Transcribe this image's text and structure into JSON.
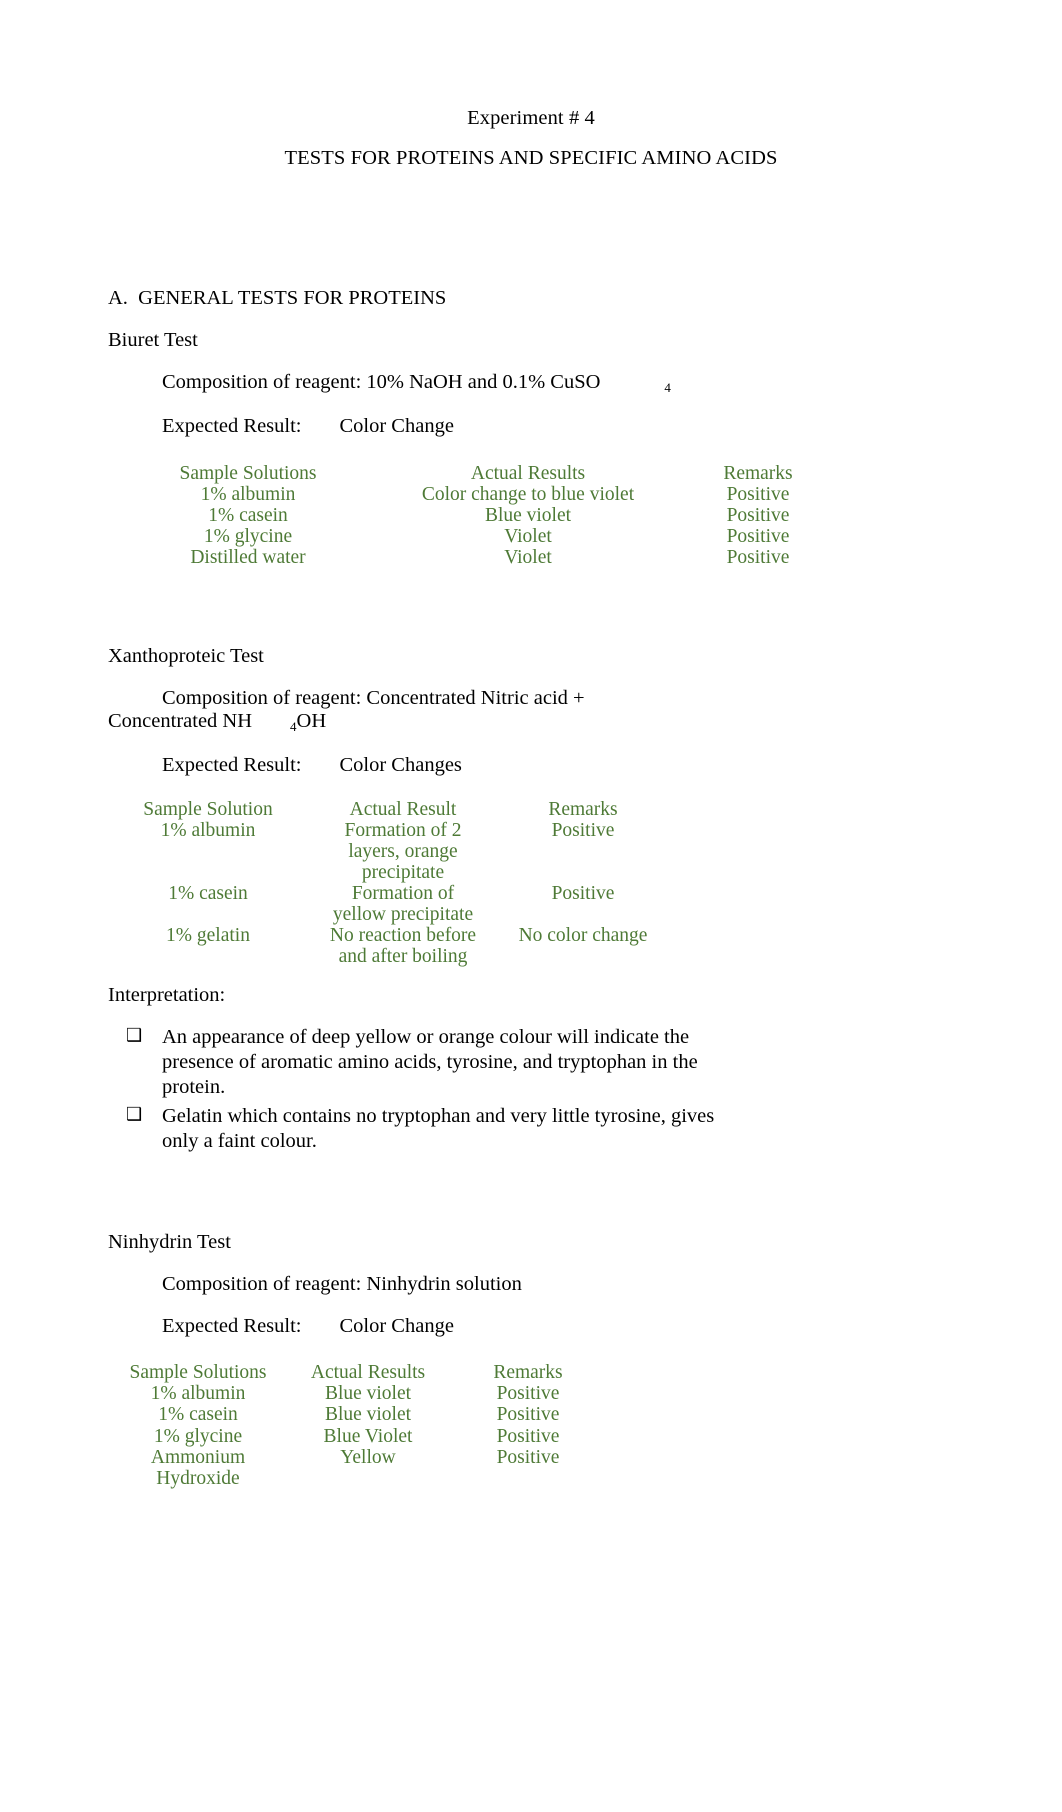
{
  "document": {
    "title": "Experiment # 4",
    "subtitle": "TESTS FOR PROTEINS AND SPECIFIC AMINO ACIDS"
  },
  "section_a": {
    "heading": "A.  GENERAL TESTS FOR PROTEINS"
  },
  "biuret": {
    "test_name": "Biuret Test",
    "composition": "Composition of reagent: 10% NaOH and 0.1% CuSO",
    "composition_subscript": "4",
    "expected_label": "Expected Result:",
    "expected_value": "Color Change",
    "headers": [
      "Sample Solutions",
      "Actual Results",
      "Remarks"
    ],
    "rows": [
      [
        "1% albumin",
        "Color change to blue violet",
        "Positive"
      ],
      [
        "1% casein",
        "Blue violet",
        "Positive"
      ],
      [
        "1% glycine",
        "Violet",
        "Positive"
      ],
      [
        "Distilled water",
        "Violet",
        "Positive"
      ]
    ]
  },
  "xanthoproteic": {
    "test_name": "Xanthoproteic Test",
    "composition_line1": "Composition of reagent: Concentrated Nitric acid +",
    "composition_line2_a": "Concentrated NH",
    "composition_subscript": "4",
    "composition_line2_b": "OH",
    "expected_label": "Expected Result:",
    "expected_value": "Color Changes",
    "headers": [
      "Sample Solution",
      "Actual Result",
      "Remarks"
    ],
    "rows": [
      {
        "sample": "1% albumin",
        "result_line1": "Formation of 2",
        "result_line2": "layers, orange",
        "result_line3": "precipitate",
        "remarks": "Positive"
      },
      {
        "sample": "1% casein",
        "result_line1": "Formation of",
        "result_line2": "yellow precipitate",
        "result_line3": "",
        "remarks": "Positive"
      },
      {
        "sample": "1% gelatin",
        "result_line1": "No reaction before",
        "result_line2": "and after boiling",
        "result_line3": "",
        "remarks": "No color change"
      }
    ],
    "interpretation_label": "Interpretation:",
    "bullet_glyph": "❑",
    "bullets": [
      "An appearance of deep yellow or orange colour will indicate the presence of aromatic amino acids, tyrosine, and tryptophan in the protein.",
      "Gelatin which contains no tryptophan and very little tyrosine, gives only a faint colour."
    ]
  },
  "ninhydrin": {
    "test_name": "Ninhydrin Test",
    "composition": "Composition of reagent: Ninhydrin solution",
    "expected_label": "Expected Result:",
    "expected_value": "Color Change",
    "headers": [
      "Sample Solutions",
      "Actual Results",
      "Remarks"
    ],
    "rows": [
      {
        "sample_line1": "1% albumin",
        "sample_line2": "",
        "result": "Blue violet",
        "remarks": "Positive"
      },
      {
        "sample_line1": "1% casein",
        "sample_line2": "",
        "result": "Blue violet",
        "remarks": "Positive"
      },
      {
        "sample_line1": "1% glycine",
        "sample_line2": "",
        "result": "Blue Violet",
        "remarks": "Positive"
      },
      {
        "sample_line1": "Ammonium",
        "sample_line2": "Hydroxide",
        "result": "Yellow",
        "remarks": "Positive"
      }
    ]
  },
  "colors": {
    "text": "#000000",
    "data_green": "#4e7a36",
    "page_background": "#ffffff"
  }
}
